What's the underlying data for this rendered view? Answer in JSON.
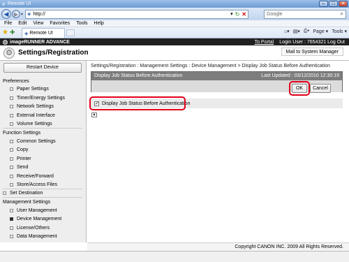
{
  "browser": {
    "window_title": "Remote UI",
    "url": "http://",
    "search_placeholder": "Google",
    "menus": [
      "File",
      "Edit",
      "View",
      "Favorites",
      "Tools",
      "Help"
    ],
    "tab_label": "Remote UI",
    "commands": [
      "Page ▾",
      "Tools ▾"
    ]
  },
  "app": {
    "product": "imageRUNNER ADVANCE",
    "to_portal": "To Portal",
    "login_user": "Login User : 7654321",
    "logout": "Log Out",
    "page_title": "Settings/Registration",
    "mail_button": "Mail to System Manager"
  },
  "sidebar": {
    "restart_button": "Restart Device",
    "sections": [
      {
        "title": "Preferences",
        "items": [
          "Paper Settings",
          "Timer/Energy Settings",
          "Network Settings",
          "External Interface",
          "Volume Settings"
        ]
      },
      {
        "title": "Function Settings",
        "items": [
          "Common Settings",
          "Copy",
          "Printer",
          "Send",
          "Receive/Forward",
          "Store/Access Files"
        ]
      },
      {
        "title": "Set Destination",
        "items": []
      },
      {
        "title": "Management Settings",
        "items": [
          "User Management",
          "Device Management",
          "License/Others",
          "Data Management"
        ]
      }
    ],
    "selected": "Device Management"
  },
  "content": {
    "breadcrumb": "Settings/Registration : Management Settings : Device Management > Display Job Status Before Authentication",
    "dialog_title": "Display Job Status Before Authentication",
    "last_updated": "Last Updated : 03/12/2010 12:30:19",
    "ok_label": "OK",
    "cancel_label": "Cancel",
    "option_label": "Display Job Status Before Authentication",
    "option_checked": true
  },
  "footer": "Copyright CANON INC. 2009 All Rights Reserved.",
  "colors": {
    "highlight": "#e2001a",
    "header": "#202020",
    "dialog_bar": "#7d7d7d"
  }
}
